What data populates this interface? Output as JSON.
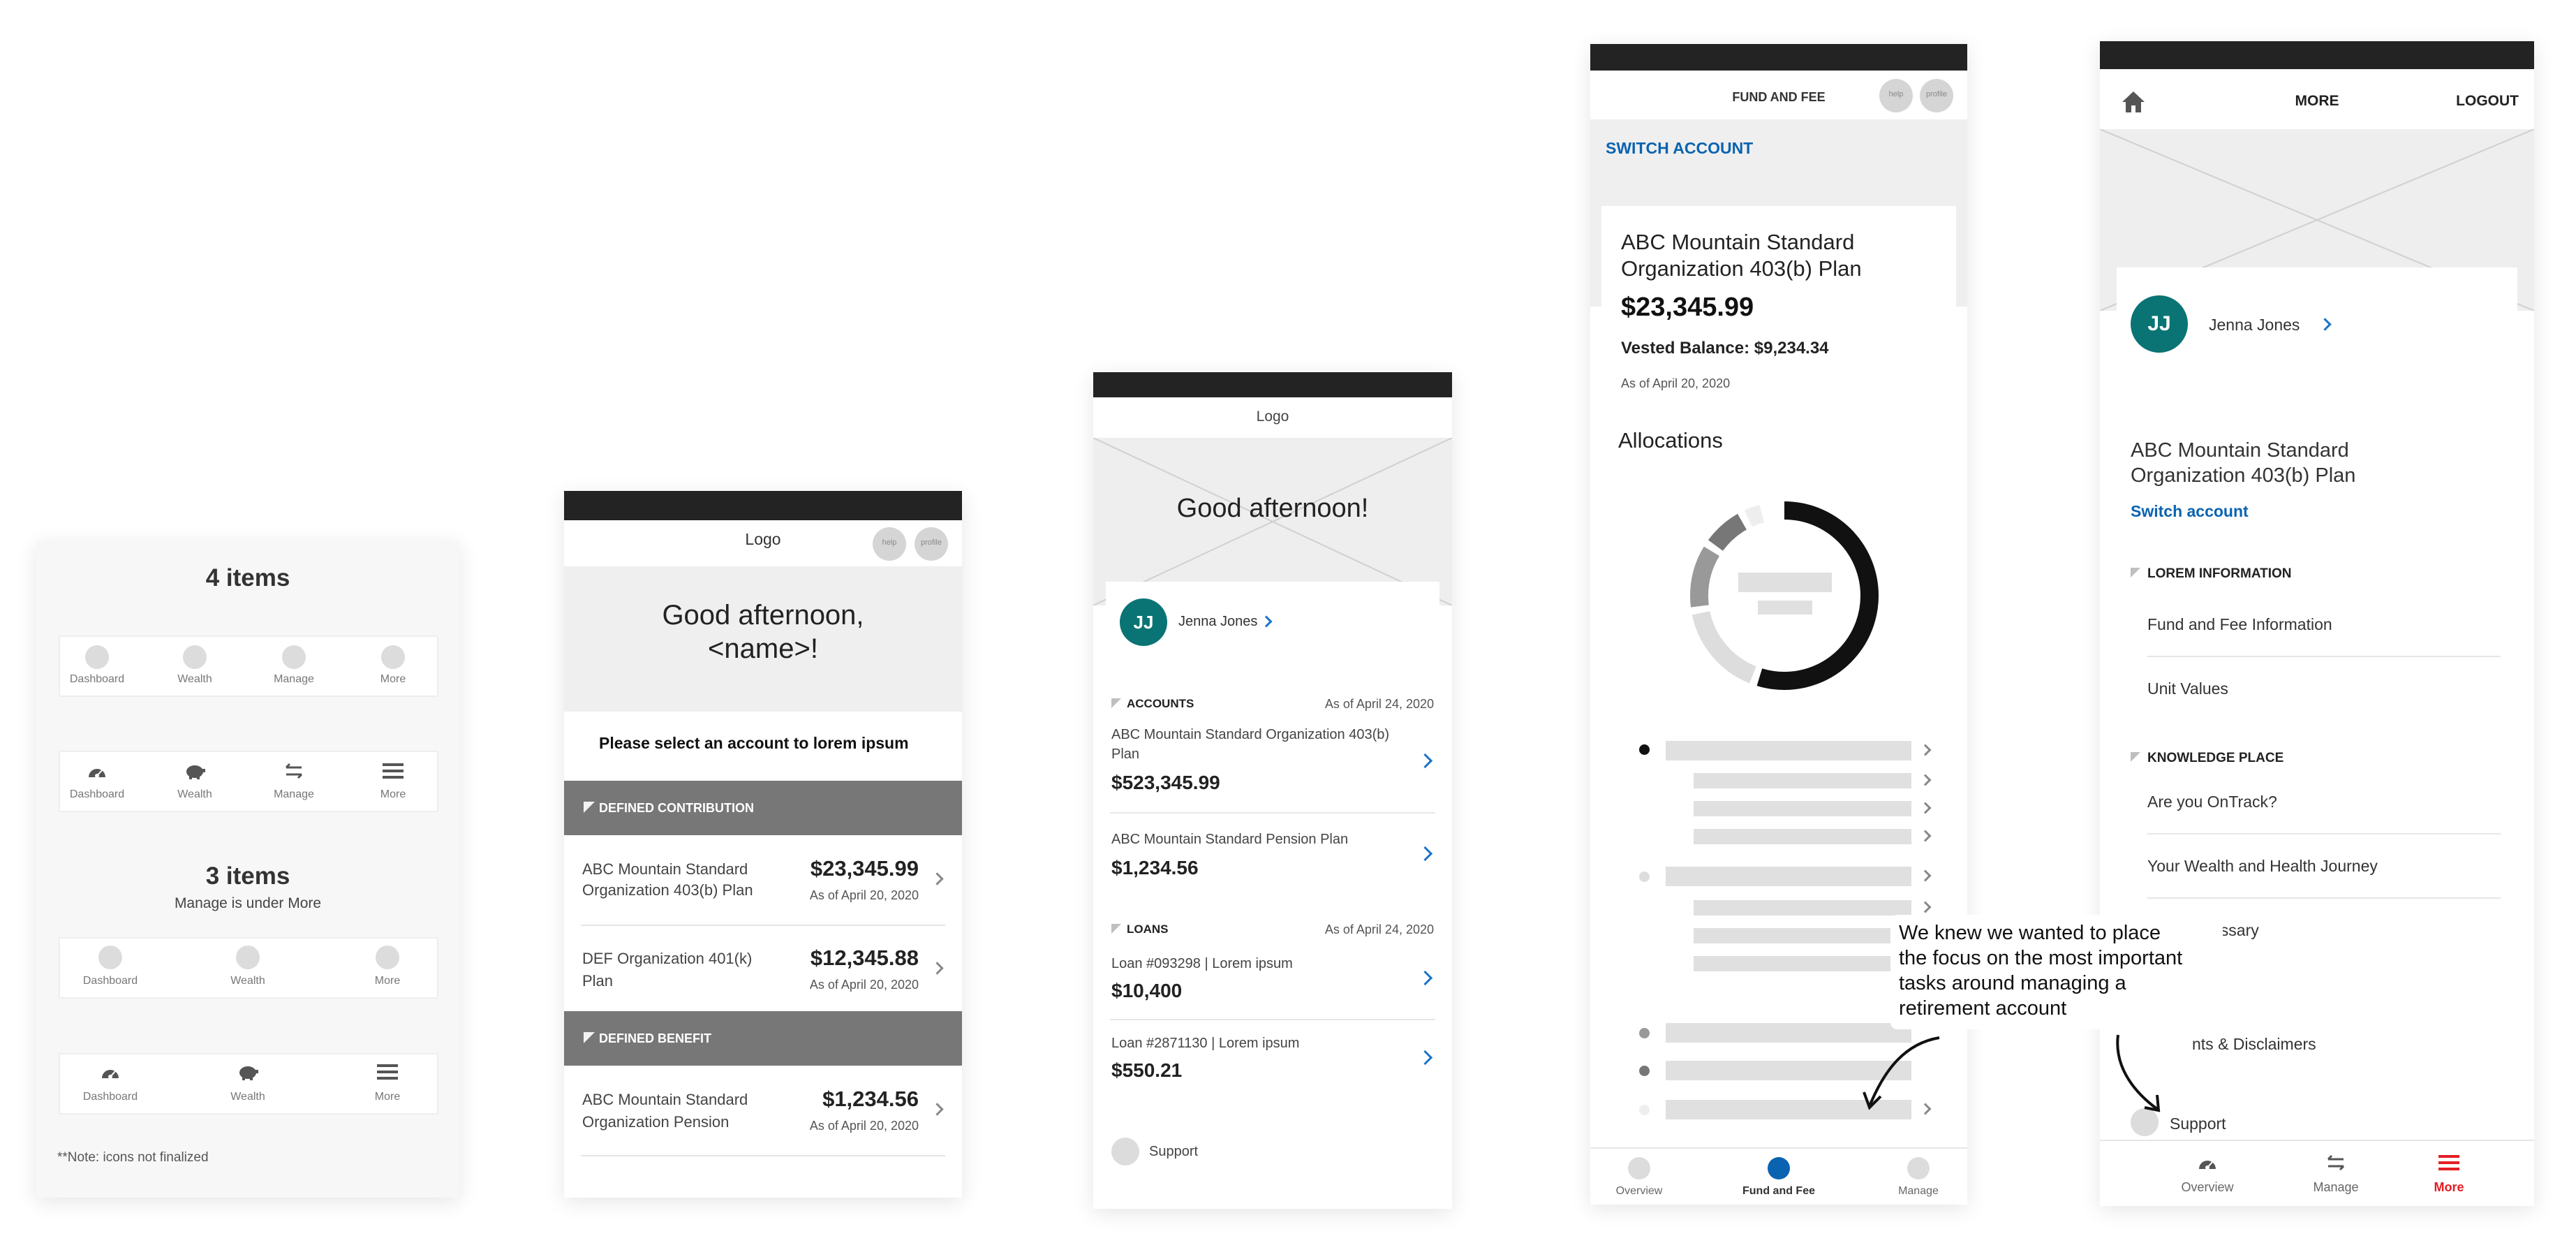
{
  "panel1": {
    "title_4": "4 items",
    "title_3": "3 items",
    "subtitle_3": "Manage is under More",
    "tabs4": [
      "Dashboard",
      "Wealth",
      "Manage",
      "More"
    ],
    "tabs3": [
      "Dashboard",
      "Wealth",
      "More"
    ],
    "note": "**Note: icons not finalized"
  },
  "screen1": {
    "logo": "Logo",
    "help": "help",
    "profile": "profile",
    "greeting_line1": "Good afternoon,",
    "greeting_line2": "<name>!",
    "prompt": "Please select an account to lorem ipsum",
    "sections": [
      {
        "title": "DEFINED CONTRIBUTION"
      },
      {
        "title": "DEFINED BENEFIT"
      }
    ],
    "accounts": [
      {
        "name1": "ABC Mountain Standard",
        "name2": "Organization 403(b) Plan",
        "amount": "$23,345.99",
        "date": "As of April 20, 2020"
      },
      {
        "name1": "DEF Organization 401(k)",
        "name2": "Plan",
        "amount": "$12,345.88",
        "date": "As of April 20, 2020"
      },
      {
        "name1": "ABC Mountain Standard",
        "name2": "Organization Pension",
        "amount": "$1,234.56",
        "date": "As of April 20, 2020"
      }
    ]
  },
  "screen2": {
    "logo": "Logo",
    "greeting": "Good afternoon!",
    "initials": "JJ",
    "user": "Jenna Jones",
    "accounts_label": "ACCOUNTS",
    "accounts_date": "As of April 24, 2020",
    "accounts": [
      {
        "name1": "ABC Mountain Standard Organization 403(b)",
        "name2": "Plan",
        "amount": "$523,345.99"
      },
      {
        "name1": "ABC Mountain Standard Pension Plan",
        "name2": "",
        "amount": "$1,234.56"
      }
    ],
    "loans_label": "LOANS",
    "loans_date": "As of April 24, 2020",
    "loans": [
      {
        "name": "Loan #093298 | Lorem ipsum",
        "amount": "$10,400"
      },
      {
        "name": "Loan #2871130 | Lorem ipsum",
        "amount": "$550.21"
      }
    ],
    "support": "Support"
  },
  "screen3": {
    "header": "FUND AND FEE",
    "help": "help",
    "profile": "profile",
    "switch": "SWITCH ACCOUNT",
    "plan1": "ABC Mountain Standard",
    "plan2": "Organization 403(b) Plan",
    "balance": "$23,345.99",
    "vested": "Vested Balance: $9,234.34",
    "asof": "As of April 20, 2020",
    "allocations": "Allocations",
    "donut_segments": [
      {
        "label": "black",
        "fraction": 0.56,
        "color": "#111111"
      },
      {
        "label": "light",
        "fraction": 0.17,
        "color": "#dddddd"
      },
      {
        "label": "mid",
        "fraction": 0.12,
        "color": "#999999"
      },
      {
        "label": "dark-gray",
        "fraction": 0.08,
        "color": "#777777"
      },
      {
        "label": "pale",
        "fraction": 0.04,
        "color": "#eeeeee"
      }
    ],
    "tabs": [
      "Overview",
      "Fund and Fee",
      "Manage"
    ],
    "accent": "#0a63b0"
  },
  "screen4": {
    "header": "MORE",
    "logout": "LOGOUT",
    "initials": "JJ",
    "user": "Jenna Jones",
    "plan1": "ABC Mountain Standard",
    "plan2": "Organization 403(b) Plan",
    "switch": "Switch account",
    "sec1": "LOREM INFORMATION",
    "items1": [
      "Fund and Fee Information",
      "Unit Values"
    ],
    "sec2": "KNOWLEDGE PLACE",
    "items2": [
      "Are you OnTrack?",
      "Your Wealth and Health Journey",
      "Terms Glossary"
    ],
    "partial": "nts & Disclaimers",
    "support": "Support",
    "tabs": [
      "Overview",
      "Manage",
      "More"
    ],
    "active_color": "#e31e24"
  },
  "annotation": {
    "line1": "We knew we wanted to place",
    "line2": "the focus on the most important",
    "line3": "tasks around managing a",
    "line4": "retirement account"
  }
}
